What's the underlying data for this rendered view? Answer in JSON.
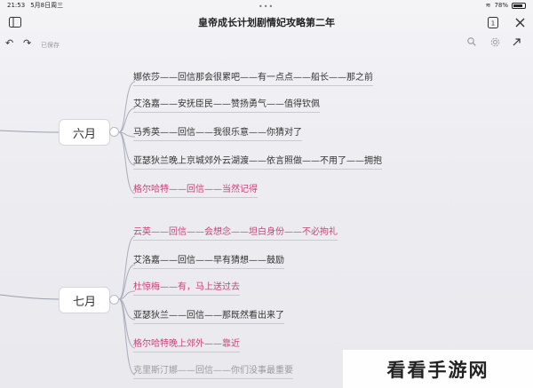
{
  "status": {
    "time": "21:53",
    "date": "5月8日周三",
    "battery": "78%"
  },
  "title": "皇帝成长计划剧情妃攻略第二年",
  "toolbar": {
    "saved": "已保存"
  },
  "months": [
    {
      "label": "六月",
      "items": [
        {
          "text": "娜依莎——回信那会很累吧——有一点点——船长——那之前",
          "style": "normal"
        },
        {
          "text": "艾洛嘉——安抚臣民——赞扬勇气——值得钦佩",
          "style": "normal"
        },
        {
          "text": "马秀英——回信——我很乐意——你猜对了",
          "style": "normal"
        },
        {
          "text": "亚瑟狄兰晚上京城郊外云湖渡——依言照做——不用了——拥抱",
          "style": "normal"
        },
        {
          "text": "格尔哈特——回信——当然记得",
          "style": "pink"
        }
      ]
    },
    {
      "label": "七月",
      "items": [
        {
          "text": "云英——回信——会想念——坦白身份——不必拘礼",
          "style": "pink"
        },
        {
          "text": "艾洛嘉——回信——早有猜想——鼓励",
          "style": "normal"
        },
        {
          "text": "杜惊梅——有，马上送过去",
          "style": "pink"
        },
        {
          "text": "亚瑟狄兰——回信——那既然看出来了",
          "style": "normal"
        },
        {
          "text": "格尔哈特晚上郊外——靠近",
          "style": "pink"
        },
        {
          "text": "克里斯汀娜——回信——你们没事最重要",
          "style": "faded"
        }
      ]
    }
  ],
  "watermark": "看看手游网",
  "colors": {
    "pink": "#c3457a",
    "text": "#333333",
    "line": "#c9c9d2"
  }
}
